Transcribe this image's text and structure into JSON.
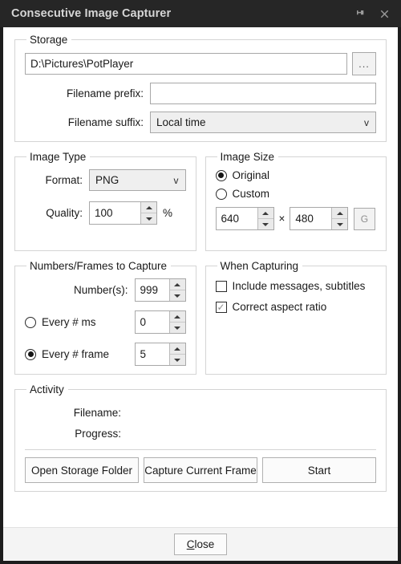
{
  "window": {
    "title": "Consecutive Image Capturer",
    "pin_icon": "pin-icon",
    "close_icon": "close-icon"
  },
  "storage": {
    "legend": "Storage",
    "path_value": "D:\\Pictures\\PotPlayer",
    "path_placeholder": "",
    "browse_label": "...",
    "prefix_label": "Filename prefix:",
    "prefix_value": "",
    "suffix_label": "Filename suffix:",
    "suffix_value": "Local time"
  },
  "image_type": {
    "legend": "Image Type",
    "format_label": "Format:",
    "format_value": "PNG",
    "quality_label": "Quality:",
    "quality_value": "100",
    "percent": "%"
  },
  "image_size": {
    "legend": "Image Size",
    "original_label": "Original",
    "original_selected": true,
    "custom_label": "Custom",
    "custom_selected": false,
    "width_value": "640",
    "times": "×",
    "height_value": "480",
    "g_label": "G"
  },
  "frames": {
    "legend": "Numbers/Frames to Capture",
    "numbers_label": "Number(s):",
    "numbers_value": "999",
    "every_ms_label": "Every # ms",
    "every_ms_selected": false,
    "every_ms_value": "0",
    "every_frame_label": "Every # frame",
    "every_frame_selected": true,
    "every_frame_value": "5"
  },
  "when_capturing": {
    "legend": "When Capturing",
    "include_messages_label": "Include messages, subtitles",
    "include_messages_checked": false,
    "correct_aspect_label": "Correct aspect ratio",
    "correct_aspect_checked": true,
    "check_glyph": "✓"
  },
  "activity": {
    "legend": "Activity",
    "filename_label": "Filename:",
    "filename_value": "",
    "progress_label": "Progress:",
    "progress_value": "",
    "open_folder_label": "Open Storage Folder",
    "capture_frame_label": "Capture Current Frame",
    "start_label": "Start"
  },
  "footer": {
    "close_label": "Close",
    "close_accel": "C",
    "close_rest": "lose"
  },
  "colors": {
    "titlebar_bg": "#262626",
    "window_frame": "#1d1d1d",
    "content_bg": "#ffffff",
    "footer_bg": "#f4f4f4",
    "group_border": "#d4d4d4",
    "input_border": "#a8a8a8"
  }
}
